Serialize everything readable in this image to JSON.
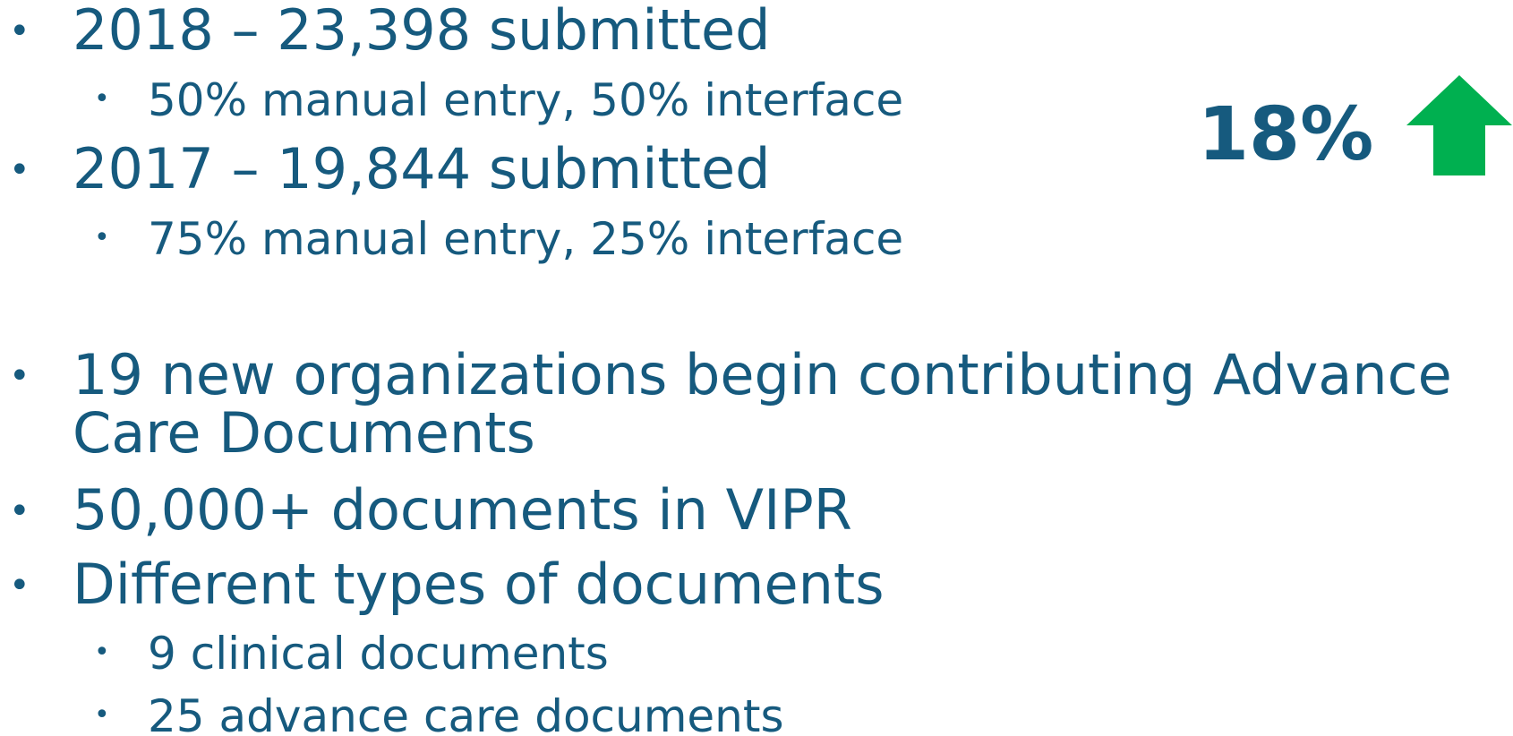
{
  "bullets": {
    "b1": "2018 – 23,398 submitted",
    "b1_sub": "50% manual entry, 50% interface",
    "b2": "2017 – 19,844 submitted",
    "b2_sub": "75% manual entry, 25% interface",
    "b3_line1": "19 new organizations begin contributing Advance",
    "b3_line2": "Care Documents",
    "b4": "50,000+ documents in VIPR",
    "b5": "Different types of documents",
    "b5_sub1": "9 clinical documents",
    "b5_sub2": "25 advance care documents"
  },
  "stat": {
    "value": "18%",
    "arrow_icon": "up-arrow-icon",
    "arrow_color": "#00b050"
  },
  "colors": {
    "text": "#165a7e",
    "background": "#ffffff"
  }
}
